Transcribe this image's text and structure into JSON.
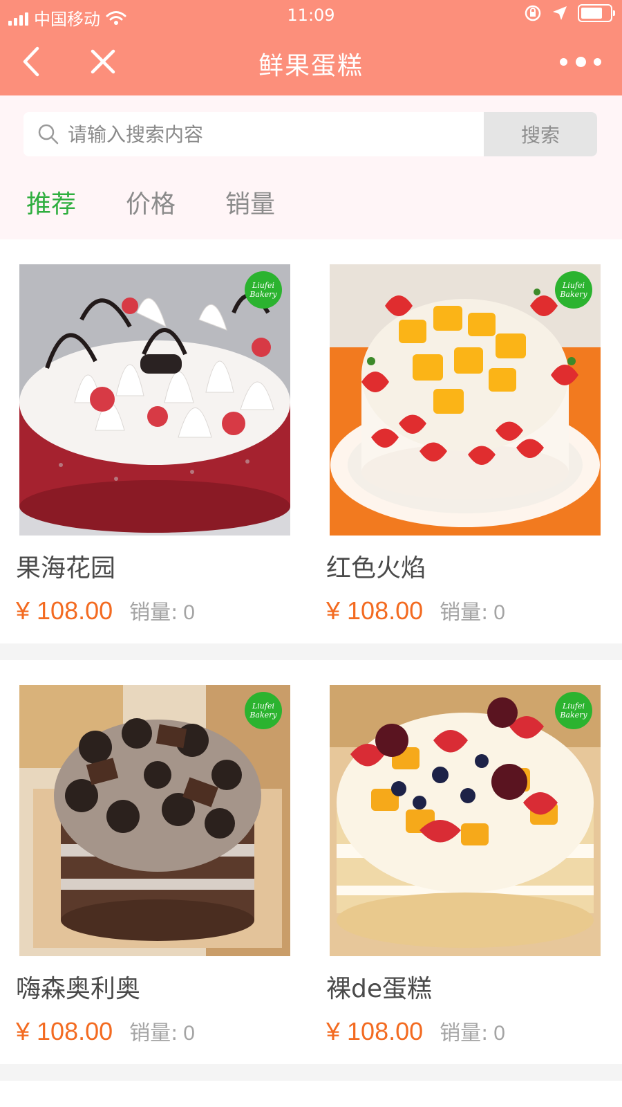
{
  "status_bar": {
    "carrier": "中国移动",
    "time": "11:09",
    "battery_level": 0.75
  },
  "nav": {
    "title": "鲜果蛋糕",
    "back_icon": "chevron-left-icon",
    "close_icon": "close-icon",
    "more_icon": "more-dots-icon"
  },
  "search": {
    "placeholder": "请输入搜索内容",
    "button_label": "搜索"
  },
  "tabs": [
    {
      "label": "推荐",
      "active": true
    },
    {
      "label": "价格",
      "active": false
    },
    {
      "label": "销量",
      "active": false
    }
  ],
  "products": [
    {
      "name": "果海花园",
      "price": "¥ 108.00",
      "sales_label": "销量:",
      "sales_value": "0",
      "badge": "Liufei Bakery"
    },
    {
      "name": "红色火焰",
      "price": "¥ 108.00",
      "sales_label": "销量:",
      "sales_value": "0",
      "badge": "Liufei Bakery"
    },
    {
      "name": "嗨森奥利奥",
      "price": "¥ 108.00",
      "sales_label": "销量:",
      "sales_value": "0",
      "badge": "Liufei Bakery"
    },
    {
      "name": "裸de蛋糕",
      "price": "¥ 108.00",
      "sales_label": "销量:",
      "sales_value": "0",
      "badge": "Liufei Bakery"
    }
  ],
  "colors": {
    "header": "#fc8f7b",
    "active_tab": "#2fae3f",
    "price": "#f36b21",
    "search_bg": "#fff5f7"
  }
}
